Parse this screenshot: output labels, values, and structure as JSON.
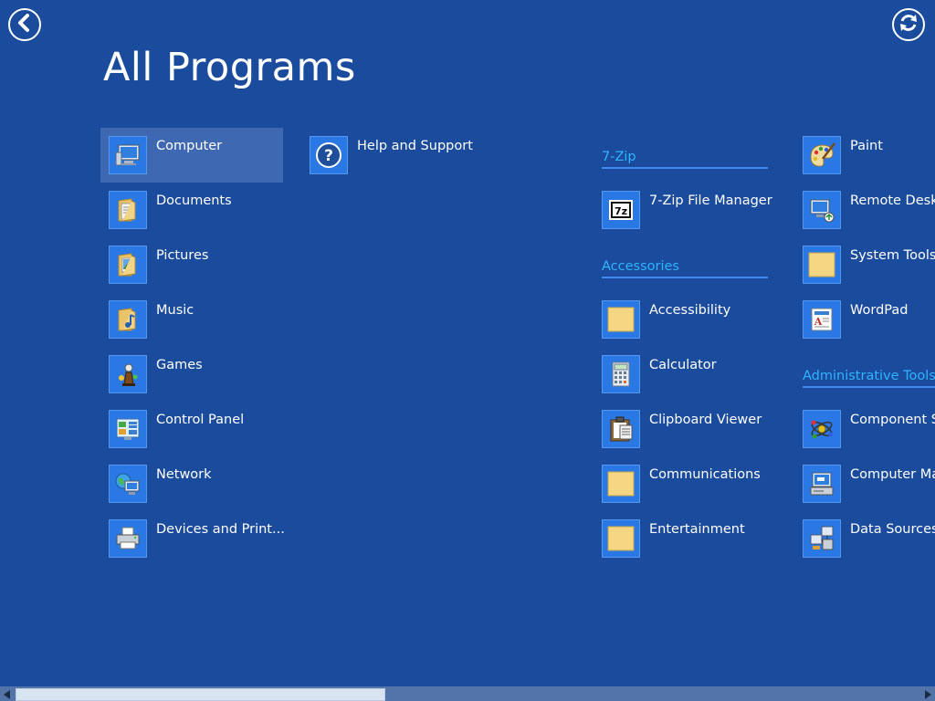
{
  "header": {
    "title": "All Programs",
    "back_icon": "back-arrow-icon",
    "refresh_icon": "refresh-icon"
  },
  "pinned": [
    {
      "label": "Computer",
      "icon": "computer-icon",
      "selected": true
    },
    {
      "label": "Documents",
      "icon": "documents-folder-icon"
    },
    {
      "label": "Pictures",
      "icon": "pictures-folder-icon"
    },
    {
      "label": "Music",
      "icon": "music-folder-icon"
    },
    {
      "label": "Games",
      "icon": "games-icon"
    },
    {
      "label": "Control Panel",
      "icon": "control-panel-icon"
    },
    {
      "label": "Network",
      "icon": "network-icon"
    },
    {
      "label": "Devices and Print...",
      "icon": "printer-icon"
    },
    {
      "label": "Help and Support",
      "icon": "help-icon"
    }
  ],
  "groups": {
    "zip": {
      "header": "7-Zip",
      "items": [
        {
          "label": "7-Zip File Manager",
          "icon": "7zip-icon"
        }
      ]
    },
    "accessories": {
      "header": "Accessories",
      "items": [
        {
          "label": "Accessibility",
          "icon": "folder-icon"
        },
        {
          "label": "Calculator",
          "icon": "calculator-icon"
        },
        {
          "label": "Clipboard Viewer",
          "icon": "clipboard-icon"
        },
        {
          "label": "Communications",
          "icon": "folder-icon"
        },
        {
          "label": "Entertainment",
          "icon": "folder-icon"
        },
        {
          "label": "Paint",
          "icon": "paint-icon"
        },
        {
          "label": "Remote Deskt",
          "icon": "remote-desktop-icon"
        },
        {
          "label": "System Tools",
          "icon": "folder-icon"
        },
        {
          "label": "WordPad",
          "icon": "wordpad-icon"
        }
      ]
    },
    "admin": {
      "header": "Administrative Tools",
      "items": [
        {
          "label": "Component Se",
          "icon": "component-services-icon"
        },
        {
          "label": "Computer Ma",
          "icon": "computer-management-icon"
        },
        {
          "label": "Data Sources (",
          "icon": "data-sources-icon"
        }
      ]
    }
  },
  "colors": {
    "background": "#1a4b9c",
    "group_header": "#30b4ff",
    "tile_icon_bg": "#2a78e4",
    "selected_tile": "#3e68b2"
  },
  "scrollbar": {
    "left_arrow_icon": "scroll-left-arrow-icon",
    "right_arrow_icon": "scroll-right-arrow-icon",
    "position": 0.0
  }
}
